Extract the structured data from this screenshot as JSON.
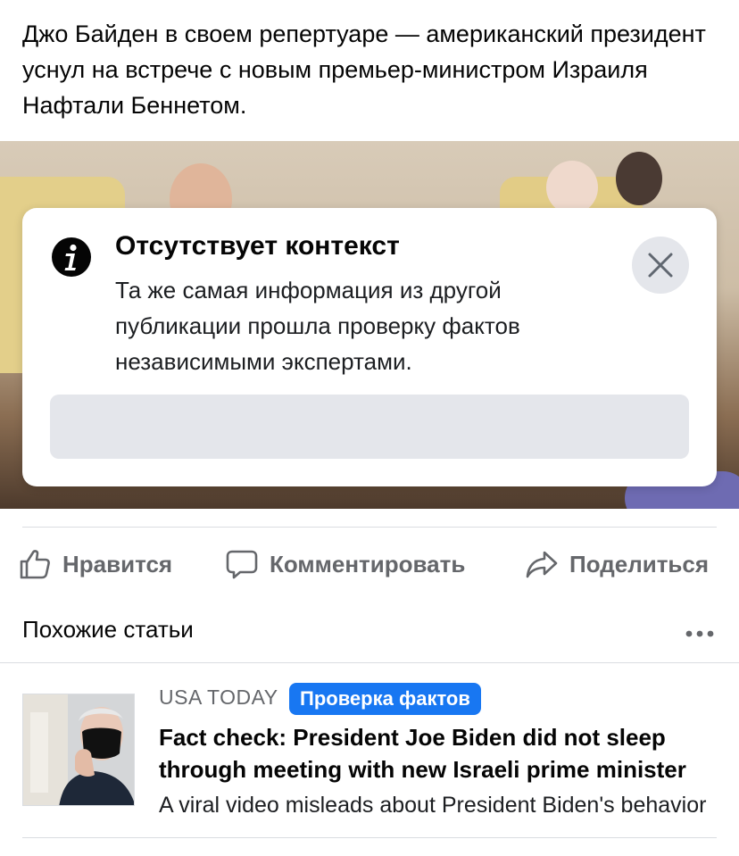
{
  "post": {
    "text": "Джо Байден в своем репертуаре — американский президент уснул на встрече с новым премьер-министром Израиля Нафтали Беннетом."
  },
  "fact_check_overlay": {
    "title": "Отсутствует контекст",
    "body": "Та же самая информация из другой публикации прошла проверку фактов независимыми экспертами.",
    "close_icon": "close-icon",
    "info_icon": "info-icon"
  },
  "actions": {
    "like_label": "Нравится",
    "comment_label": "Комментировать",
    "share_label": "Поделиться"
  },
  "related": {
    "title": "Похожие статьи",
    "items": [
      {
        "source": "USA TODAY",
        "badge": "Проверка фактов",
        "title_line1": "Fact check: President Joe Biden did not sleep",
        "title_line2": "through meeting with new Israeli prime minister",
        "description": "A viral video misleads about President Biden's behavior"
      }
    ]
  },
  "colors": {
    "accent": "#1877f2",
    "muted_text": "#65676b",
    "button_gray": "#e4e6eb"
  }
}
